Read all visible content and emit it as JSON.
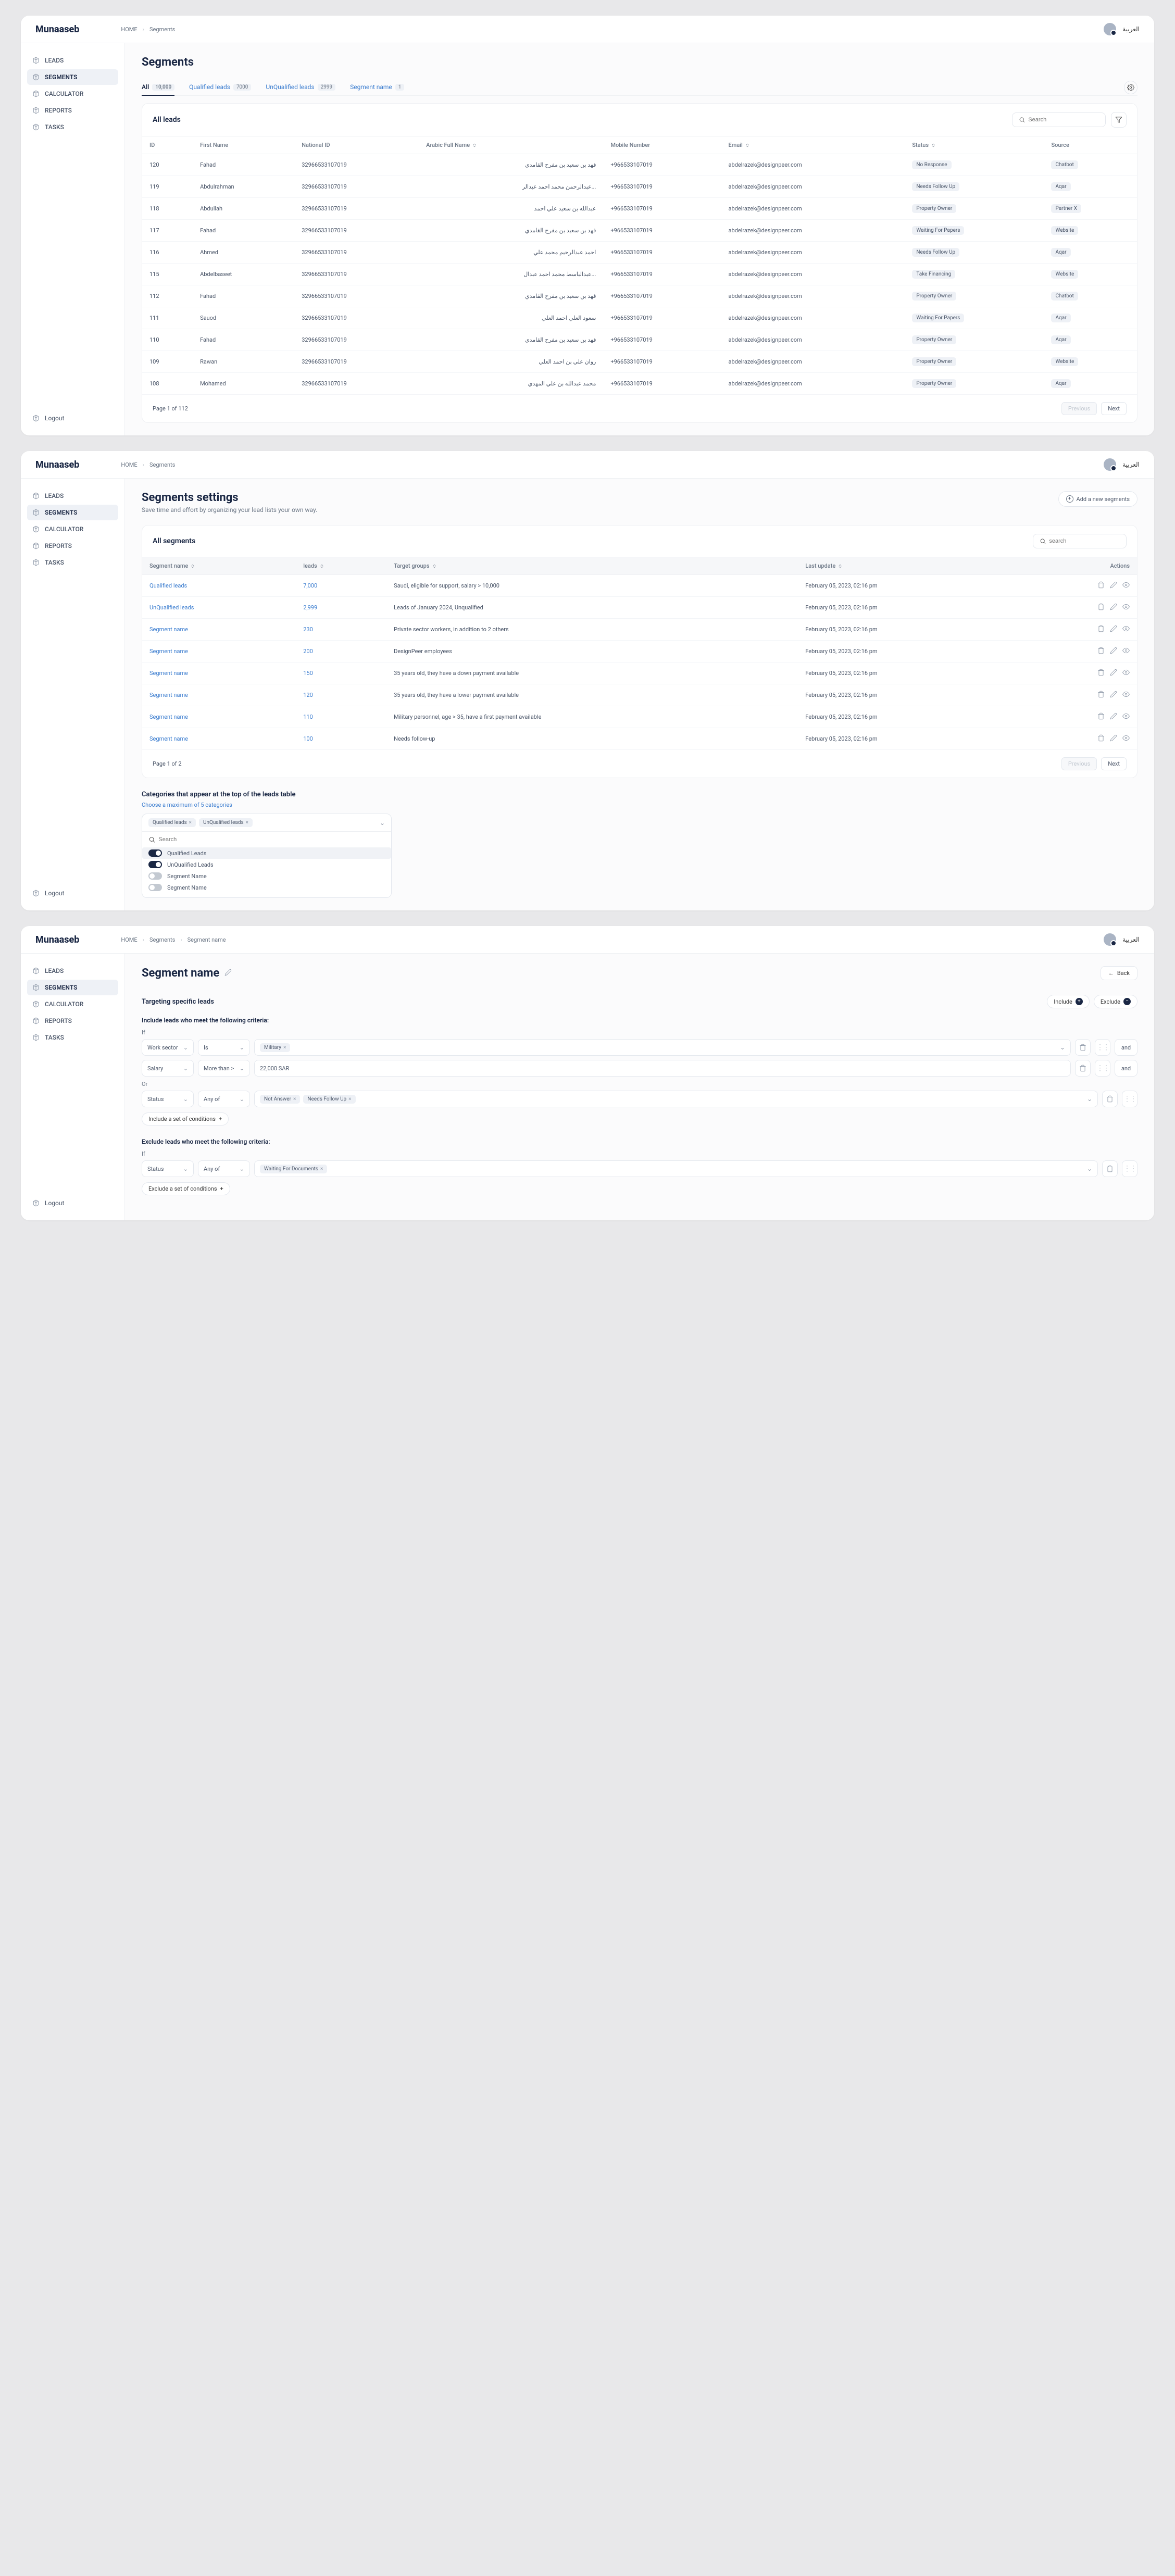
{
  "logo": "Munaaseb",
  "lang": "العربية",
  "nav": {
    "leads": "LEADS",
    "segments": "SEGMENTS",
    "calculator": "CALCULATOR",
    "reports": "REPORTS",
    "tasks": "TASKS",
    "logout": "Logout"
  },
  "crumb": {
    "home": "HOME",
    "segments": "Segments",
    "segname": "Segment name"
  },
  "page1": {
    "title": "Segments",
    "tabs": {
      "all": "All",
      "all_c": "10,000",
      "qual": "Qualified leads",
      "qual_c": "7000",
      "unqual": "UnQualified leads",
      "unqual_c": "2999",
      "seg": "Segment name",
      "seg_c": "1"
    },
    "card_title": "All leads",
    "search_ph": "Search",
    "cols": {
      "id": "ID",
      "fn": "First Name",
      "nid": "National ID",
      "afn": "Arabic Full Name",
      "mob": "Mobile Number",
      "email": "Email",
      "status": "Status",
      "source": "Source"
    },
    "rows": [
      {
        "id": "120",
        "fn": "Fahad",
        "nid": "32966533107019",
        "afn": "فهد بن سعيد بن مفرح القامدي",
        "mob": "+966533107019",
        "email": "abdelrazek@designpeer.com",
        "status": "No Response",
        "source": "Chatbot"
      },
      {
        "id": "119",
        "fn": "Abdulrahman",
        "nid": "32966533107019",
        "afn": "...عبدالرحمن محمد احمد عبدالر",
        "mob": "+966533107019",
        "email": "abdelrazek@designpeer.com",
        "status": "Needs Follow Up",
        "source": "Aqar"
      },
      {
        "id": "118",
        "fn": "Abdullah",
        "nid": "32966533107019",
        "afn": "عبدالله بن سعيد علي احمد",
        "mob": "+966533107019",
        "email": "abdelrazek@designpeer.com",
        "status": "Property Owner",
        "source": "Partner X"
      },
      {
        "id": "117",
        "fn": "Fahad",
        "nid": "32966533107019",
        "afn": "فهد بن سعيد بن مفرح القامدي",
        "mob": "+966533107019",
        "email": "abdelrazek@designpeer.com",
        "status": "Waiting For Papers",
        "source": "Website"
      },
      {
        "id": "116",
        "fn": "Ahmed",
        "nid": "32966533107019",
        "afn": "احمد عبدالرحيم محمد علي",
        "mob": "+966533107019",
        "email": "abdelrazek@designpeer.com",
        "status": "Needs Follow Up",
        "source": "Aqar"
      },
      {
        "id": "115",
        "fn": "Abdelbaseet",
        "nid": "32966533107019",
        "afn": "...عبدالباسط محمد احمد عبدال",
        "mob": "+966533107019",
        "email": "abdelrazek@designpeer.com",
        "status": "Take Financing",
        "source": "Website"
      },
      {
        "id": "112",
        "fn": "Fahad",
        "nid": "32966533107019",
        "afn": "فهد بن سعيد بن مفرح القامدي",
        "mob": "+966533107019",
        "email": "abdelrazek@designpeer.com",
        "status": "Property Owner",
        "source": "Chatbot"
      },
      {
        "id": "111",
        "fn": "Sauod",
        "nid": "32966533107019",
        "afn": "سعود العلي احمد العلي",
        "mob": "+966533107019",
        "email": "abdelrazek@designpeer.com",
        "status": "Waiting For Papers",
        "source": "Aqar"
      },
      {
        "id": "110",
        "fn": "Fahad",
        "nid": "32966533107019",
        "afn": "فهد بن سعيد بن مفرح القامدي",
        "mob": "+966533107019",
        "email": "abdelrazek@designpeer.com",
        "status": "Property Owner",
        "source": "Aqar"
      },
      {
        "id": "109",
        "fn": "Rawan",
        "nid": "32966533107019",
        "afn": "روان علي بن احمد العلي",
        "mob": "+966533107019",
        "email": "abdelrazek@designpeer.com",
        "status": "Property Owner",
        "source": "Website"
      },
      {
        "id": "108",
        "fn": "Mohamed",
        "nid": "32966533107019",
        "afn": "محمد عبدالله بن علي المهدي",
        "mob": "+966533107019",
        "email": "abdelrazek@designpeer.com",
        "status": "Property Owner",
        "source": "Aqar"
      }
    ],
    "pag": "Page 1 of 112",
    "prev": "Previous",
    "next": "Next"
  },
  "page2": {
    "title": "Segments settings",
    "sub": "Save time and effort by organizing your lead lists your own way.",
    "add_btn": "Add a new segments",
    "card_title": "All segments",
    "search_ph": "search",
    "cols": {
      "name": "Segment name",
      "leads": "leads",
      "tg": "Target groups",
      "lu": "Last update",
      "act": "Actions"
    },
    "rows": [
      {
        "name": "Qualified leads",
        "leads": "7,000",
        "tg": "Saudi, eligible for support, salary > 10,000",
        "lu": "February 05, 2023, 02:16 pm"
      },
      {
        "name": "UnQualified leads",
        "leads": "2,999",
        "tg": "Leads of January 2024, Unqualified",
        "lu": "February 05, 2023, 02:16 pm"
      },
      {
        "name": "Segment name",
        "leads": "230",
        "tg": "Private sector workers, in addition to 2 others",
        "lu": "February 05, 2023, 02:16 pm"
      },
      {
        "name": "Segment name",
        "leads": "200",
        "tg": "DesignPeer employees",
        "lu": "February 05, 2023, 02:16 pm"
      },
      {
        "name": "Segment name",
        "leads": "150",
        "tg": "35 years old, they have a down payment available",
        "lu": "February 05, 2023, 02:16 pm"
      },
      {
        "name": "Segment name",
        "leads": "120",
        "tg": "35 years old, they have a lower payment available",
        "lu": "February 05, 2023, 02:16 pm"
      },
      {
        "name": "Segment name",
        "leads": "110",
        "tg": "Military personnel, age > 35, have a first payment available",
        "lu": "February 05, 2023, 02:16 pm"
      },
      {
        "name": "Segment name",
        "leads": "100",
        "tg": "Needs follow-up",
        "lu": "February 05, 2023, 02:16 pm"
      }
    ],
    "pag": "Page 1 of 2",
    "prev": "Previous",
    "next": "Next",
    "cat_title": "Categories that appear at the top of the leads table",
    "cat_sub": "Choose a maximum of 5 categories",
    "ms_chips": [
      "Qualified leads",
      "UnQualified leads"
    ],
    "ms_search": "Search",
    "ms_opts": [
      {
        "label": "Qualified Leads",
        "on": true
      },
      {
        "label": "UnQualified Leads",
        "on": true
      },
      {
        "label": "Segment Name",
        "on": false
      },
      {
        "label": "Segment Name",
        "on": false
      }
    ]
  },
  "page3": {
    "title": "Segment name",
    "back": "Back",
    "section": "Targeting specific leads",
    "include_btn": "Include",
    "exclude_btn": "Exclude",
    "inc_heading": "Include leads who meet the following criteria:",
    "exc_heading": "Exclude leads who meet the following criteria:",
    "if": "If",
    "or": "Or",
    "and": "and",
    "cond1": {
      "field": "Work sector",
      "op": "Is",
      "val": "Military"
    },
    "cond2": {
      "field": "Salary",
      "op": "More than >",
      "val": "22,000 SAR"
    },
    "cond3": {
      "field": "Status",
      "op": "Any of",
      "v1": "Not Answer",
      "v2": "Needs Follow Up"
    },
    "cond4": {
      "field": "Status",
      "op": "Any of",
      "val": "Waiting For Documents"
    },
    "inc_set": "Include a set of conditions",
    "exc_set": "Exclude a set of conditions"
  }
}
